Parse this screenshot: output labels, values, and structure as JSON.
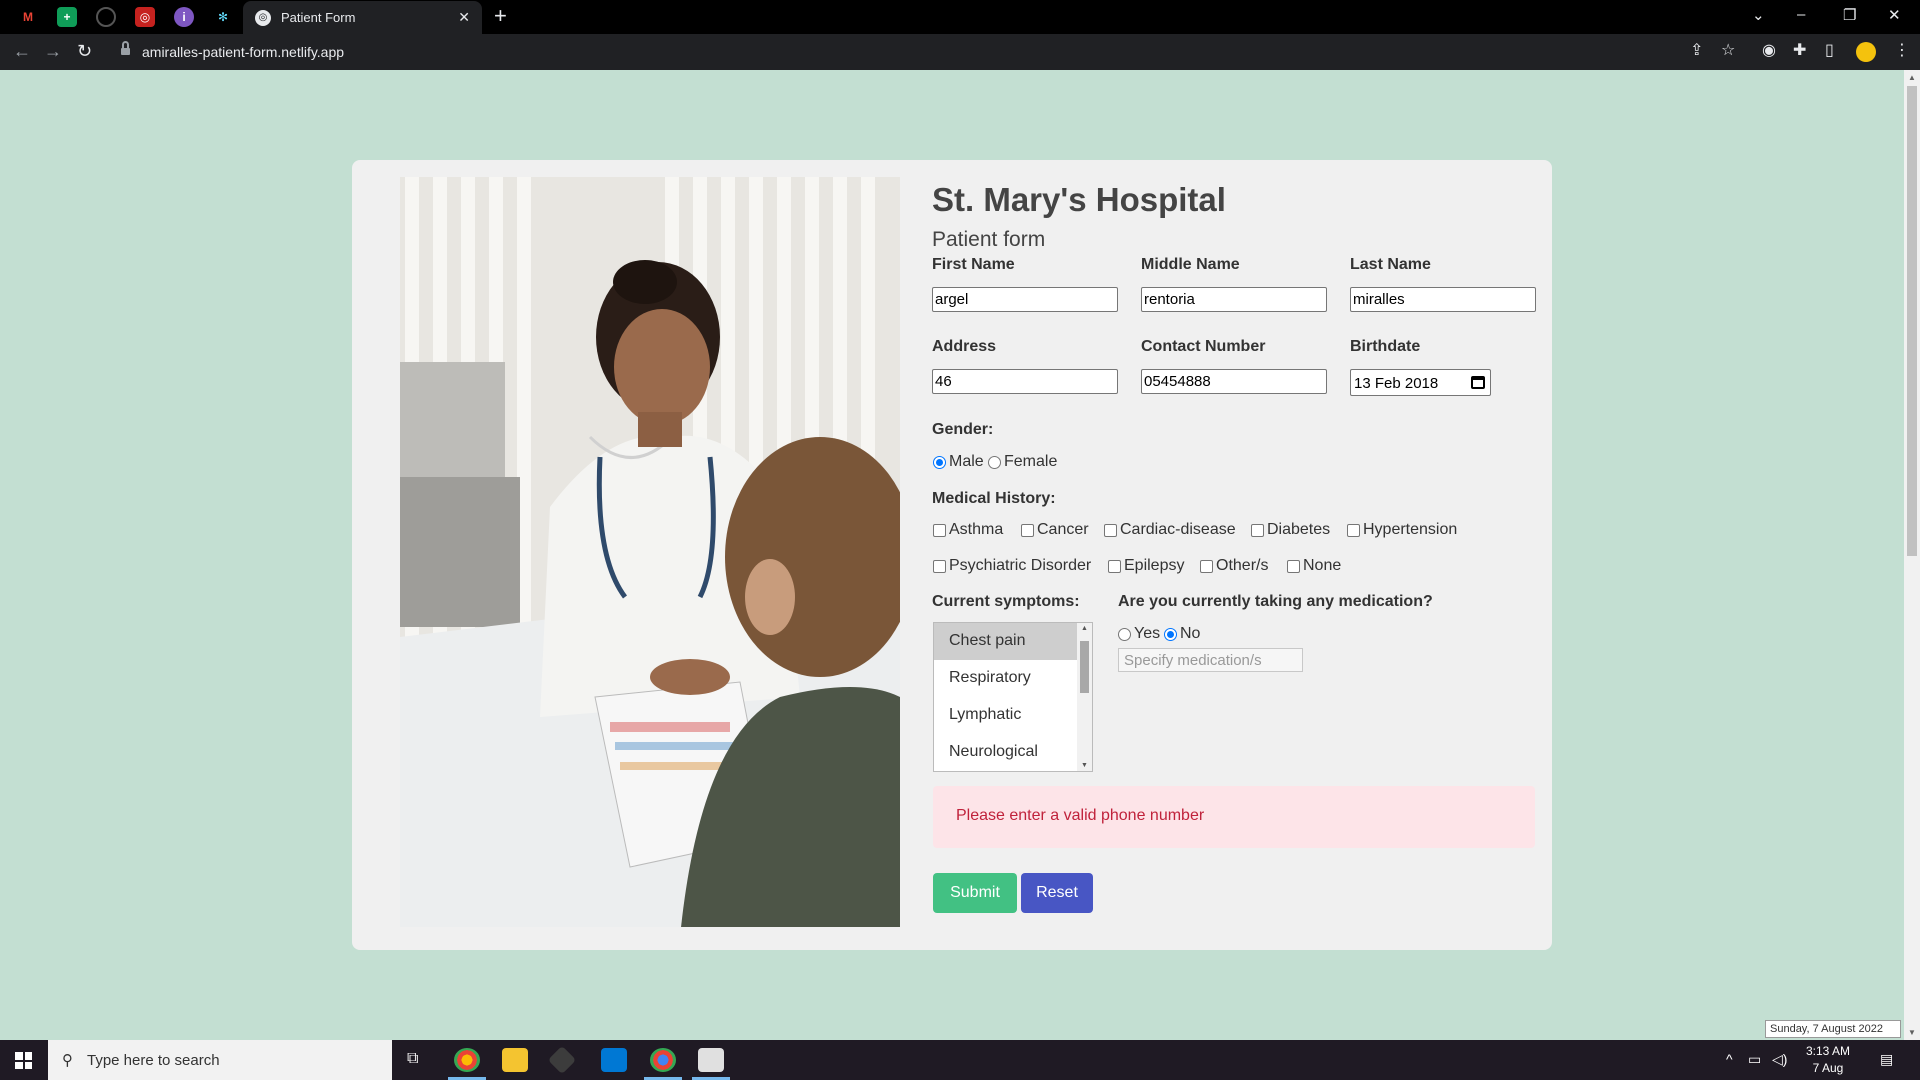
{
  "browser": {
    "active_tab_title": "Patient Form",
    "url": "amiralles-patient-form.netlify.app",
    "other_tabs": [
      "gmail-icon",
      "sheets-icon",
      "github-icon",
      "app-icon",
      "app2-icon",
      "react-icon"
    ]
  },
  "page": {
    "hospital_name": "St. Mary's Hospital",
    "form_title": "Patient form"
  },
  "form": {
    "first_name": {
      "label": "First Name",
      "value": "argel"
    },
    "middle_name": {
      "label": "Middle Name",
      "value": "rentoria"
    },
    "last_name": {
      "label": "Last Name",
      "value": "miralles"
    },
    "address": {
      "label": "Address",
      "value": "46"
    },
    "contact": {
      "label": "Contact Number",
      "value": "05454888"
    },
    "birthdate": {
      "label": "Birthdate",
      "value": "13 Feb 2018"
    },
    "gender": {
      "label": "Gender:",
      "options": [
        "Male",
        "Female"
      ],
      "selected": "Male"
    },
    "medical_history": {
      "label": "Medical History:",
      "options": [
        "Asthma",
        "Cancer",
        "Cardiac-disease",
        "Diabetes",
        "Hypertension",
        "Psychiatric Disorder",
        "Epilepsy",
        "Other/s",
        "None"
      ]
    },
    "symptoms": {
      "label": "Current symptoms:",
      "options": [
        "Chest pain",
        "Respiratory",
        "Lymphatic",
        "Neurological"
      ],
      "selected": "Chest pain"
    },
    "medication": {
      "label": "Are you currently taking any medication?",
      "options": [
        "Yes",
        "No"
      ],
      "selected": "No",
      "placeholder": "Specify medication/s"
    },
    "error_message": "Please enter a valid phone number",
    "submit_label": "Submit",
    "reset_label": "Reset"
  },
  "taskbar": {
    "search_placeholder": "Type here to search",
    "time": "3:13 AM",
    "date": "7 Aug 2022",
    "tooltip": "Sunday, 7 August 2022"
  }
}
